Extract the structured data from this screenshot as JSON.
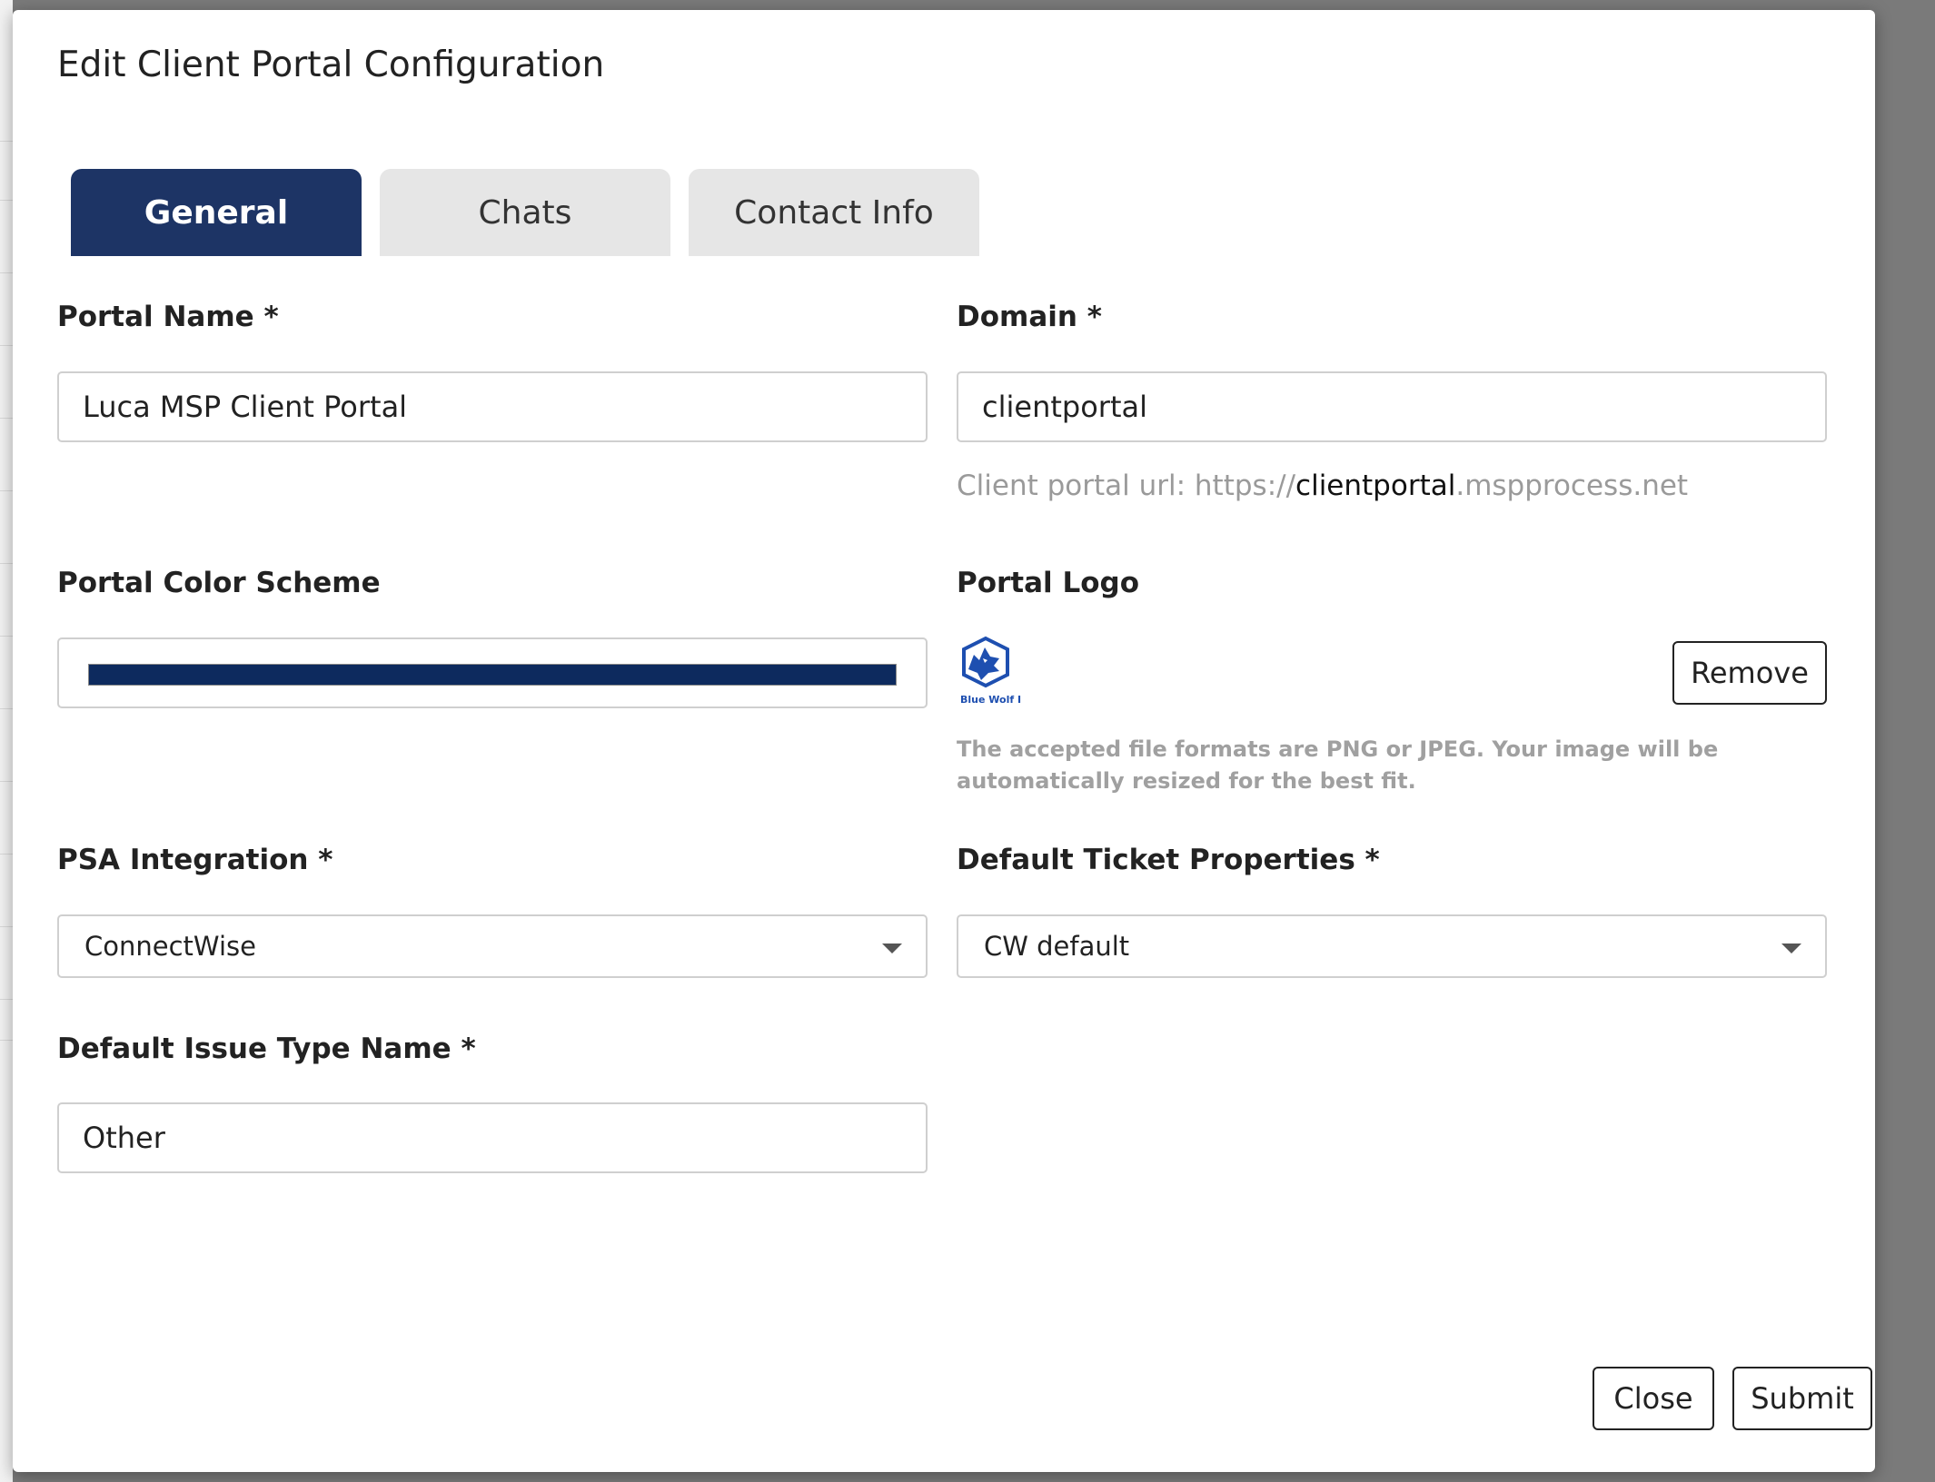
{
  "dialog": {
    "title": "Edit Client Portal Configuration",
    "tabs": [
      {
        "label": "General",
        "active": true
      },
      {
        "label": "Chats",
        "active": false
      },
      {
        "label": "Contact Info",
        "active": false
      }
    ]
  },
  "form": {
    "portal_name": {
      "label": "Portal Name *",
      "value": "Luca MSP Client Portal"
    },
    "domain": {
      "label": "Domain *",
      "value": "clientportal",
      "hint_prefix": "Client portal url: https://",
      "hint_domain": "clientportal",
      "hint_suffix": ".mspprocess.net"
    },
    "color_scheme": {
      "label": "Portal Color Scheme",
      "color": "#0d2a5e"
    },
    "logo": {
      "label": "Portal Logo",
      "logo_text": "Blue Wolf IT",
      "remove_label": "Remove",
      "help": "The accepted file formats are PNG or JPEG. Your image will be automatically resized for the best fit."
    },
    "psa_integration": {
      "label": "PSA Integration *",
      "value": "ConnectWise"
    },
    "default_ticket_properties": {
      "label": "Default Ticket Properties *",
      "value": "CW default"
    },
    "default_issue_type": {
      "label": "Default Issue Type Name *",
      "value": "Other"
    }
  },
  "footer": {
    "close_label": "Close",
    "submit_label": "Submit"
  },
  "colors": {
    "primary": "#1d3465",
    "tab_inactive": "#e6e6e6",
    "hint": "#9a9a9a"
  }
}
